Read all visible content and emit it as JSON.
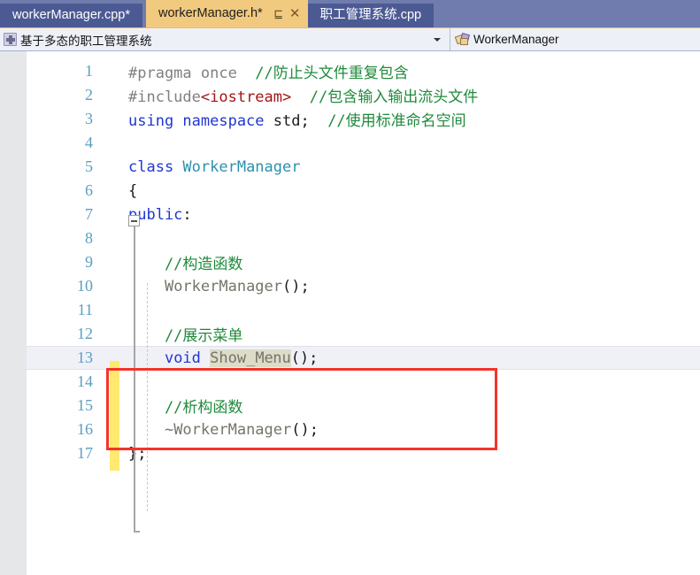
{
  "window": {
    "app": "Visual Studio C++ Editor"
  },
  "tabs": [
    {
      "label": "workerManager.cpp*",
      "state": "inactive",
      "name": "tab-workermanager-cpp"
    },
    {
      "label": "workerManager.h*",
      "state": "active",
      "name": "tab-workermanager-h",
      "pin_icon": "pin-icon",
      "pin_glyph": "⊑",
      "close_icon": "close-icon",
      "close_glyph": "✕"
    },
    {
      "label": "职工管理系统.cpp",
      "state": "inactive",
      "name": "tab-zhigong-guanli-xitong-cpp"
    }
  ],
  "navbar": {
    "left_icon": "namespace-icon",
    "left_text": "基于多态的职工管理系统",
    "dropdown_icon": "chevron-down-icon",
    "right_icon": "class-icon",
    "right_text": "WorkerManager"
  },
  "colors": {
    "tab_active_bg": "#f2ca7f",
    "tab_inactive_bg": "#4c5a93",
    "tabstrip_bg": "#6f7cad",
    "navbar_bg": "#eef0f8",
    "editor_bg": "#ffffff",
    "margin_bg": "#e6e7e8",
    "linenumber": "#5c9ec2",
    "comment": "#1f8a3b",
    "keyword": "#1f37d0",
    "preprocessor": "#808080",
    "header_string": "#a31515",
    "type_name": "#2b91af",
    "function_name": "#78736b",
    "change_bar": "#ffe970",
    "annotation_rect": "#f4332a",
    "current_line": "#f0f1f7",
    "word_highlight": "#dcdcc8"
  },
  "editor": {
    "caret_line": 13,
    "caret_column_label": "Show_Me|nu",
    "highlighted_word": "Show_Menu",
    "fold_icon": "collapse-minus-icon",
    "lines": [
      {
        "n": "1",
        "tokens": [
          {
            "t": "#pragma once  ",
            "c": "c-pre"
          },
          {
            "t": "//防止头文件重复包含",
            "c": "c-comment"
          }
        ]
      },
      {
        "n": "2",
        "tokens": [
          {
            "t": "#include",
            "c": "c-pre"
          },
          {
            "t": "<iostream>",
            "c": "c-header"
          },
          {
            "t": "  ",
            "c": "c-plain"
          },
          {
            "t": "//包含输入输出流头文件",
            "c": "c-comment"
          }
        ]
      },
      {
        "n": "3",
        "tokens": [
          {
            "t": "using namespace ",
            "c": "c-keyword"
          },
          {
            "t": "std;  ",
            "c": "c-plain"
          },
          {
            "t": "//使用标准命名空间",
            "c": "c-comment"
          }
        ]
      },
      {
        "n": "4",
        "tokens": []
      },
      {
        "n": "5",
        "tokens": [
          {
            "t": "class ",
            "c": "c-keyword"
          },
          {
            "t": "WorkerManager",
            "c": "c-type"
          }
        ]
      },
      {
        "n": "6",
        "tokens": [
          {
            "t": "{",
            "c": "c-punc"
          }
        ]
      },
      {
        "n": "7",
        "tokens": [
          {
            "t": "public",
            "c": "c-keyword"
          },
          {
            "t": ":",
            "c": "c-punc"
          }
        ]
      },
      {
        "n": "8",
        "tokens": []
      },
      {
        "n": "9",
        "tokens": [
          {
            "t": "    //构造函数",
            "c": "c-comment"
          }
        ]
      },
      {
        "n": "10",
        "tokens": [
          {
            "t": "    ",
            "c": "c-plain"
          },
          {
            "t": "WorkerManager",
            "c": "c-fn"
          },
          {
            "t": "();",
            "c": "c-punc"
          }
        ]
      },
      {
        "n": "11",
        "tokens": []
      },
      {
        "n": "12",
        "tokens": [
          {
            "t": "    //展示菜单",
            "c": "c-comment"
          }
        ]
      },
      {
        "n": "13",
        "tokens": [
          {
            "t": "    ",
            "c": "c-plain"
          },
          {
            "t": "void ",
            "c": "c-keyword"
          },
          {
            "t": "Show_Me",
            "c": "c-fn hl-word"
          },
          {
            "caret": true
          },
          {
            "t": "nu",
            "c": "c-fn hl-word"
          },
          {
            "t": "();",
            "c": "c-punc"
          }
        ]
      },
      {
        "n": "14",
        "tokens": []
      },
      {
        "n": "15",
        "tokens": [
          {
            "t": "    //析构函数",
            "c": "c-comment"
          }
        ]
      },
      {
        "n": "16",
        "tokens": [
          {
            "t": "    ",
            "c": "c-plain"
          },
          {
            "t": "~WorkerManager",
            "c": "c-fn"
          },
          {
            "t": "();",
            "c": "c-punc"
          }
        ]
      },
      {
        "n": "17",
        "tokens": [
          {
            "t": "};",
            "c": "c-punc"
          }
        ]
      }
    ]
  }
}
